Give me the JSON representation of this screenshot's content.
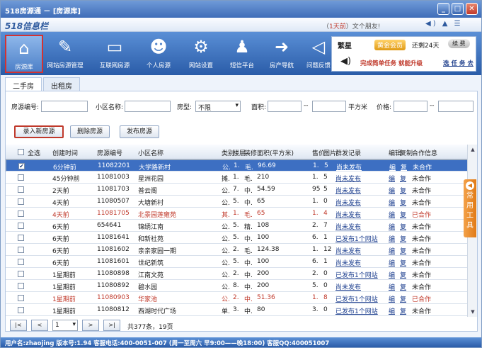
{
  "window": {
    "title": "518房源通 － [房源库]"
  },
  "infobar": {
    "logo": "518信息栏",
    "ticker_open": "（",
    "ticker_days": "1天前",
    "ticker_rest": "）文个朋友!",
    "controls": "◀) ▲ ☰"
  },
  "toolbar": [
    {
      "label": "房源库",
      "icon": "house-icon",
      "glyph": "⌂",
      "active": true
    },
    {
      "label": "网站房源管理",
      "icon": "edit-icon",
      "glyph": "✎",
      "active": false
    },
    {
      "label": "互联网房源",
      "icon": "computer-icon",
      "glyph": "▭",
      "active": false
    },
    {
      "label": "个人房源",
      "icon": "user-chat-icon",
      "glyph": "☻",
      "active": false
    },
    {
      "label": "网站设置",
      "icon": "gears-icon",
      "glyph": "⚙",
      "active": false
    },
    {
      "label": "短信平台",
      "icon": "users-icon",
      "glyph": "♟",
      "active": false
    },
    {
      "label": "房产导航",
      "icon": "arrow-right-icon",
      "glyph": "➜",
      "active": false
    },
    {
      "label": "问题反馈",
      "icon": "speaker-icon",
      "glyph": "◁",
      "active": false
    }
  ],
  "user": {
    "name": "繁星",
    "level": "黄金会员",
    "days_left": "还剩24天",
    "renew": "续 费",
    "task": "完成简单任务 就能升级",
    "gift": "选 任 务 去"
  },
  "tabs": [
    "二手房",
    "出租房"
  ],
  "search": {
    "code_label": "房源编号:",
    "community_label": "小区名称:",
    "type_label": "房型:",
    "type_value": "不限",
    "area_label": "面积:",
    "area_sep": "--",
    "area_unit": "平方米",
    "price_label": "价格:",
    "price_sep": "--"
  },
  "actions": {
    "add": "录入新房源",
    "delete": "删除房源",
    "publish": "发布房源"
  },
  "grid": {
    "headers": [
      "全选",
      "创建时间",
      "房源编号",
      "小区名称",
      "类别",
      "楼层",
      "装修",
      "面积(平方米)",
      "售价",
      "图片",
      "群发记录",
      "编辑",
      "复制",
      "合作信息"
    ],
    "rows": [
      {
        "time": "6分钟前",
        "code": "11082201",
        "name": "大学路新村",
        "t1": "公.",
        "t2": "1.",
        "t3": "毛.",
        "area": "96.69",
        "price": "1.",
        "pic": "5",
        "rec": "尚未发布",
        "ed": "编",
        "cp": "复",
        "coop": "未合作",
        "checked": true,
        "style": "sel"
      },
      {
        "time": "45分钟前",
        "code": "11081003",
        "name": "星洲花园",
        "t1": "摊.",
        "t2": "1.",
        "t3": "毛.",
        "area": "210",
        "price": "1.",
        "pic": "5",
        "rec": "尚未发布",
        "ed": "编",
        "cp": "复",
        "coop": "未合作",
        "checked": false,
        "style": ""
      },
      {
        "time": "2天前",
        "code": "11081703",
        "name": "普云阁",
        "t1": "公.",
        "t2": "7.",
        "t3": "中.",
        "area": "54.59",
        "price": "95",
        "pic": "5",
        "rec": "尚未发布",
        "ed": "编",
        "cp": "复",
        "coop": "未合作",
        "checked": false,
        "style": ""
      },
      {
        "time": "4天前",
        "code": "11080507",
        "name": "大塘新村",
        "t1": "公.",
        "t2": "5.",
        "t3": "中.",
        "area": "65",
        "price": "1.",
        "pic": "0",
        "rec": "尚未发布",
        "ed": "编",
        "cp": "复",
        "coop": "未合作",
        "checked": false,
        "style": ""
      },
      {
        "time": "4天前",
        "code": "11081705",
        "name": "北景园莲雍苑",
        "t1": "其.",
        "t2": "1.",
        "t3": "毛.",
        "area": "65",
        "price": "1.",
        "pic": "4",
        "rec": "尚未发布",
        "ed": "编",
        "cp": "复",
        "coop": "已合作",
        "checked": false,
        "style": "red"
      },
      {
        "time": "6天前",
        "code": "654641",
        "name": "锦绣江南",
        "t1": "公.",
        "t2": "5.",
        "t3": "精.",
        "area": "108",
        "price": "2.",
        "pic": "7",
        "rec": "尚未发布",
        "ed": "编",
        "cp": "复",
        "coop": "未合作",
        "checked": false,
        "style": ""
      },
      {
        "time": "6天前",
        "code": "11081641",
        "name": "和新社苑",
        "t1": "公.",
        "t2": "5.",
        "t3": "中.",
        "area": "100",
        "price": "6.",
        "pic": "1",
        "rec": "已发布1个网站",
        "ed": "编",
        "cp": "复",
        "coop": "未合作",
        "checked": false,
        "style": ""
      },
      {
        "time": "6天前",
        "code": "11081602",
        "name": "亲亲家园一期",
        "t1": "公.",
        "t2": "2.",
        "t3": "毛.",
        "area": "124.38",
        "price": "1.",
        "pic": "12",
        "rec": "尚未发布",
        "ed": "编",
        "cp": "复",
        "coop": "未合作",
        "checked": false,
        "style": ""
      },
      {
        "time": "6天前",
        "code": "11081601",
        "name": "世纪新筑",
        "t1": "公.",
        "t2": "5.",
        "t3": "中.",
        "area": "100",
        "price": "6.",
        "pic": "1",
        "rec": "尚未发布",
        "ed": "编",
        "cp": "复",
        "coop": "未合作",
        "checked": false,
        "style": ""
      },
      {
        "time": "1星期前",
        "code": "11080898",
        "name": "江南文苑",
        "t1": "公.",
        "t2": "2.",
        "t3": "中.",
        "area": "200",
        "price": "2.",
        "pic": "0",
        "rec": "已发布1个网站",
        "ed": "编",
        "cp": "复",
        "coop": "未合作",
        "checked": false,
        "style": ""
      },
      {
        "time": "1星期前",
        "code": "11080892",
        "name": "碧水园",
        "t1": "公.",
        "t2": "8.",
        "t3": "中.",
        "area": "200",
        "price": "5.",
        "pic": "0",
        "rec": "尚未发布",
        "ed": "编",
        "cp": "复",
        "coop": "未合作",
        "checked": false,
        "style": ""
      },
      {
        "time": "1星期前",
        "code": "11080903",
        "name": "华家池",
        "t1": "公.",
        "t2": "2.",
        "t3": "中.",
        "area": "51.36",
        "price": "1.",
        "pic": "8",
        "rec": "已发布1个网站",
        "ed": "编",
        "cp": "复",
        "coop": "已合作",
        "checked": false,
        "style": "red"
      },
      {
        "time": "1星期前",
        "code": "11080812",
        "name": "西湖时代广场",
        "t1": "单.",
        "t2": "3.",
        "t3": "中.",
        "area": "80",
        "price": "3.",
        "pic": "0",
        "rec": "已发布1个网站",
        "ed": "编",
        "cp": "复",
        "coop": "未合作",
        "checked": false,
        "style": ""
      }
    ]
  },
  "pager": {
    "first": "|<",
    "prev": "<",
    "page": "1",
    "next": ">",
    "last": ">|",
    "summary": "共377条，19页"
  },
  "side": {
    "chars": [
      "常",
      "用",
      "工",
      "具"
    ]
  },
  "status": "用户名:zhaojing  版本号:1.94  客服电话:400-0051-007 (周一至周六 早9:00——晚18:00) 客服QQ:400051007"
}
